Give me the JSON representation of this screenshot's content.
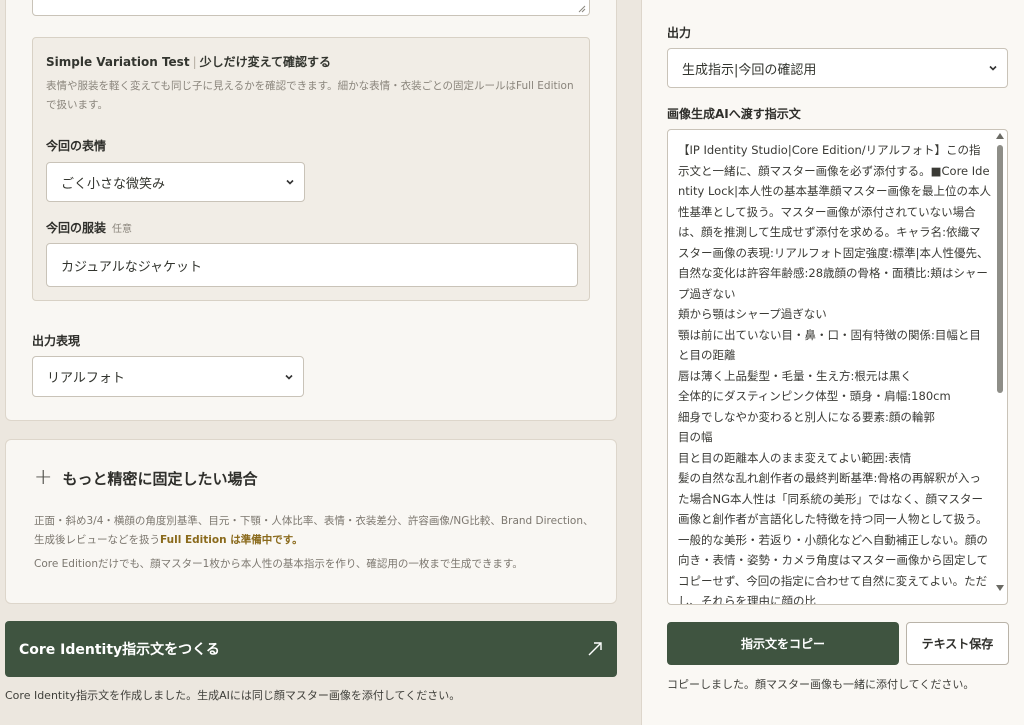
{
  "variation": {
    "title": "Simple Variation Test",
    "title_separator": "|",
    "title_jp": "少しだけ変えて確認する",
    "description": "表情や服装を軽く変えても同じ子に見えるかを確認できます。細かな表情・衣装ごとの固定ルールはFull Editionで扱います。",
    "expression_label": "今回の表情",
    "expression_value": "ごく小さな微笑み",
    "outfit_label": "今回の服装",
    "outfit_optional": "任意",
    "outfit_value": "カジュアルなジャケット"
  },
  "output_style": {
    "label": "出力表現",
    "value": "リアルフォト"
  },
  "more": {
    "plus": "+",
    "title": "もっと精密に固定したい場合",
    "desc_main": "正面・斜め3/4・横顔の角度別基準、目元・下顎・人体比率、表情・衣装差分、許容画像/NG比較、Brand Direction、生成後レビューなどを扱う",
    "desc_accent": "Full Edition は準備中です。",
    "note": "Core Editionだけでも、顔マスター1枚から本人性の基本指示を作り、確認用の一枚まで生成できます。"
  },
  "primary_button": {
    "label": "Core Identity指示文をつくる"
  },
  "status_left": "Core Identity指示文を作成しました。生成AIには同じ顔マスター画像を添付してください。",
  "right": {
    "output_label": "出力",
    "output_value": "生成指示|今回の確認用",
    "prompt_label": "画像生成AIへ渡す指示文",
    "prompt_text": "【IP Identity Studio|Core Edition/リアルフォト】この指示文と一緒に、顔マスター画像を必ず添付する。■Core Identity Lock|本人性の基本基準顔マスター画像を最上位の本人性基準として扱う。マスター画像が添付されていない場合は、顔を推測して生成せず添付を求める。キャラ名:依織マスター画像の表現:リアルフォト固定強度:標準|本人性優先、自然な変化は許容年齢感:28歳顔の骨格・面積比:頬はシャープ過ぎない\n頬から顎はシャープ過ぎない\n顎は前に出ていない目・鼻・口・固有特徴の関係:目幅と目と目の距離\n唇は薄く上品髪型・毛量・生え方:根元は黒く\n全体的にダスティンピンク体型・頭身・肩幅:180cm\n細身でしなやか変わると別人になる要素:顔の輪郭\n目の幅\n目と目の距離本人のまま変えてよい範囲:表情\n髪の自然な乱れ創作者の最終判断基準:骨格の再解釈が入った場合NG本人性は「同系統の美形」ではなく、顔マスター画像と創作者が言語化した特徴を持つ同一人物として扱う。一般的な美形・若返り・小顔化などへ自動補正しない。顔の向き・表情・姿勢・カメラ角度はマスター画像から固定してコピーせず、今回の指定に合わせて自然に変えてよい。ただし、それらを理由に顔の比",
    "copy_button": "指示文をコピー",
    "save_button": "テキスト保存",
    "status": "コピーしました。顔マスター画像も一緒に添付してください。"
  }
}
